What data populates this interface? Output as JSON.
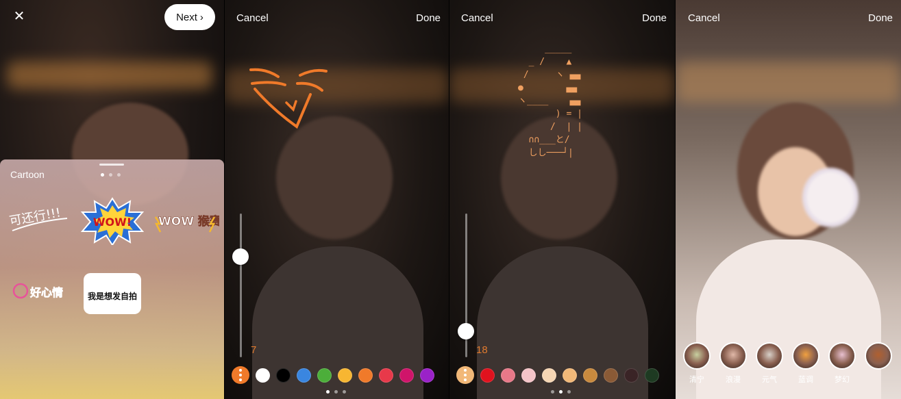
{
  "panel1": {
    "close_icon": "close-icon",
    "next_label": "Next",
    "next_chevron": "›",
    "sheet_title": "Cartoon",
    "stickers": [
      {
        "text": "可还行!!!"
      },
      {
        "text": "WOW!"
      },
      {
        "text": "WOW 猴赛雷"
      },
      {
        "text": "好心情"
      },
      {
        "text": "我是想发自拍"
      }
    ]
  },
  "panel2": {
    "cancel_label": "Cancel",
    "done_label": "Done",
    "brush_size": "7",
    "brush_level": 0.7,
    "colors": [
      "#ffffff",
      "#000000",
      "#3a86e0",
      "#4cae3a",
      "#f7b632",
      "#f07a2a",
      "#e8394a",
      "#d0146a",
      "#9a22c8"
    ]
  },
  "panel3": {
    "cancel_label": "Cancel",
    "done_label": "Done",
    "text_size": "18",
    "text_level": 0.18,
    "ascii_lines": [
      "     _____",
      "  _ /    ▲",
      " /     ヽ ▄▄",
      "●        ▄▄",
      "ヽ____    ▄▄",
      "       ) = |",
      "      /  | |",
      "  ∩∩___と/",
      "  しし───┘|"
    ],
    "colors": [
      "#e0121e",
      "#e87888",
      "#f5c4c8",
      "#f6d6b4",
      "#f2b878",
      "#c98a3e",
      "#8a5a36",
      "#3a2426",
      "#1e3a22"
    ]
  },
  "panel4": {
    "cancel_label": "Cancel",
    "done_label": "Done",
    "filters": [
      {
        "label": "清宁"
      },
      {
        "label": "浪漫"
      },
      {
        "label": "元气"
      },
      {
        "label": "蓝调"
      },
      {
        "label": "梦幻"
      },
      {
        "label": ""
      }
    ]
  },
  "pager": {
    "page": 2,
    "total": 3
  }
}
